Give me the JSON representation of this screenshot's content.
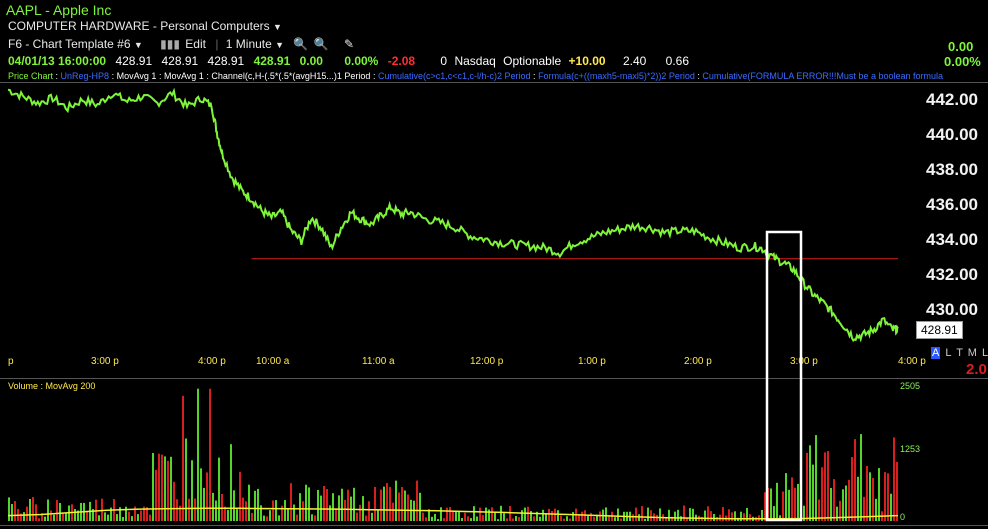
{
  "header": {
    "symbol": "AAPL",
    "separator": " - ",
    "company": "Apple Inc",
    "sector": "COMPUTER HARDWARE",
    "industry": "Personal Computers",
    "template": "F6 - Chart Template #6",
    "edit": "Edit",
    "interval": "1 Minute"
  },
  "quote": {
    "datetime": "04/01/13 16:00:00",
    "open": "428.91",
    "high": "428.91",
    "low": "428.91",
    "close": "428.91",
    "change": "0.00",
    "pct": "0.00%",
    "net": "-2.08",
    "zero": "0",
    "exchange": "Nasdaq",
    "optionable": "Optionable",
    "plus": "+10.00",
    "v1": "2.40",
    "v2": "0.66",
    "right_change": "0.00",
    "right_pct": "0.00%"
  },
  "studies": {
    "price_chart": "Price Chart",
    "s1": "UnReg-HP8",
    "s2": "MovAvg 1",
    "s3": "MovAvg 1",
    "s4": "Channel(c,H-(.5*(.5*(avgH15...)",
    "s4b": "1",
    "s4c": "Period",
    "s5": "Cumulative(c>c1,c<c1,c-l/h-c)",
    "s5b": "2",
    "s5c": "Period",
    "s6": "Formula(c+((maxh5-maxl5)*2))",
    "s6b": "2",
    "s6c": "Period",
    "s7": "Cumulative(FORMULA ERROR!!!Must be a boolean formula"
  },
  "right_panel": {
    "a": "A",
    "l": "L",
    "t": "T",
    "m": "M",
    "l2": "L",
    "value": "2.0"
  },
  "volume_panel": {
    "label": "Volume",
    "study": "MovAvg 200"
  },
  "colors": {
    "price": "#7ff53a",
    "level": "#d81e1e",
    "volume_up": "#52d62a",
    "volume_down": "#d91e1e",
    "volume_ma": "#f2ef3a",
    "highlight": "#ffffff",
    "time_axis": "#ffe94a"
  },
  "chart_data": [
    {
      "type": "line",
      "title": "AAPL - Apple Inc",
      "y_axis": "right",
      "ylim": [
        427.5,
        443.5
      ],
      "y_ticks": [
        "442.00",
        "440.00",
        "438.00",
        "436.00",
        "434.00",
        "432.00",
        "430.00"
      ],
      "x_ticks": [
        "p",
        "3:00 p",
        "4:00 p",
        "10:00 a",
        "11:00 a",
        "12:00 p",
        "1:00 p",
        "2:00 p",
        "3:00 p",
        "4:00 p"
      ],
      "last_price": "428.91",
      "horizontal_level": 433.05,
      "series": [
        {
          "x": [
            0,
            15,
            30,
            45,
            60,
            75,
            90,
            105,
            120,
            135,
            150,
            165,
            180,
            195,
            205,
            210,
            215,
            225,
            235,
            245,
            255,
            265,
            275,
            285,
            295,
            305,
            315,
            325,
            335,
            345,
            355,
            365,
            375,
            385,
            395,
            405,
            420,
            435,
            450,
            465,
            480,
            495,
            510,
            525,
            540,
            555,
            570,
            585,
            600,
            615,
            630,
            645,
            660,
            675,
            690,
            705,
            720,
            735,
            750,
            760,
            770,
            780,
            790,
            800,
            810,
            820,
            830,
            840,
            850,
            860,
            870,
            880,
            890,
            895
          ],
          "values": [
            443.1,
            442.7,
            442.3,
            442.6,
            442.0,
            442.5,
            442.2,
            442.9,
            442.4,
            442.7,
            442.3,
            442.9,
            442.1,
            442.6,
            442.1,
            440.6,
            439.4,
            437.9,
            437.1,
            436.6,
            435.9,
            435.5,
            435.8,
            434.7,
            434.1,
            435.5,
            434.9,
            433.7,
            434.9,
            435.8,
            435.4,
            435.1,
            435.6,
            436.1,
            435.7,
            435.8,
            435.4,
            435.2,
            434.9,
            434.4,
            434.2,
            434.0,
            433.9,
            433.8,
            433.7,
            433.4,
            434.0,
            434.3,
            434.6,
            434.8,
            435.0,
            434.9,
            434.6,
            434.7,
            434.7,
            434.3,
            434.0,
            433.7,
            433.8,
            433.6,
            433.1,
            432.8,
            432.4,
            431.6,
            430.9,
            430.4,
            429.8,
            429.1,
            428.4,
            428.5,
            428.8,
            429.4,
            428.8,
            428.91
          ]
        }
      ]
    },
    {
      "type": "bar",
      "title": "Volume",
      "y_axis": "right",
      "ylim": [
        0,
        2505
      ],
      "y_ticks": [
        "2505",
        "1253",
        "0"
      ],
      "moving_average_values": [
        100,
        120,
        160,
        200,
        220,
        230,
        235,
        235,
        230,
        225,
        220,
        210,
        200,
        190,
        175,
        160,
        140,
        120,
        100,
        80,
        60,
        50,
        40,
        40,
        45,
        60,
        80,
        100
      ]
    }
  ],
  "highlight_box": {
    "from_time": "2:40 p",
    "to_time": "3:00 p"
  }
}
